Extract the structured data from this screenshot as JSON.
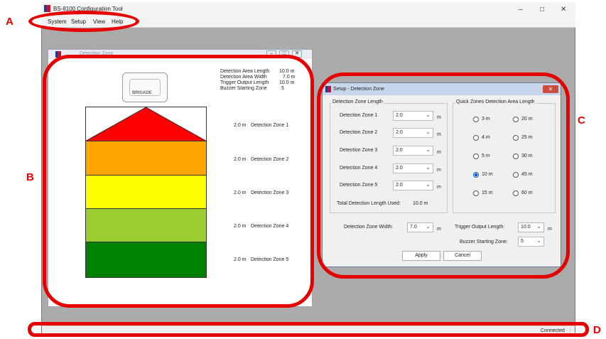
{
  "app": {
    "title": "BS-8100 Configuration Tool",
    "menu": [
      "System",
      "Setup",
      "View",
      "Help"
    ]
  },
  "detection_window": {
    "title": "Detection Zone",
    "info_labels": [
      "Detection Area Length",
      "Detection Area Width",
      "Trigger Output Length",
      "Buzzer Starting Zone"
    ],
    "info_values": [
      "10.0 m",
      "7.0 m",
      "10.0 m",
      "5"
    ],
    "device_brand": "BRIGADE",
    "zones": [
      {
        "length": "2.0 m",
        "name": "Detection Zone 1",
        "color": "#ff0000"
      },
      {
        "length": "2.0 m",
        "name": "Detection Zone 2",
        "color": "#ffa500"
      },
      {
        "length": "2.0 m",
        "name": "Detection Zone 3",
        "color": "#ffff00"
      },
      {
        "length": "2.0 m",
        "name": "Detection Zone 4",
        "color": "#9acd32"
      },
      {
        "length": "2.0 m",
        "name": "Detection Zone 5",
        "color": "#008000"
      }
    ]
  },
  "setup_dialog": {
    "title": "Setup - Detection Zone",
    "length_group_title": "Detection Zone Length",
    "zone_labels": [
      "Detection Zone 1",
      "Detection Zone 2",
      "Detection Zone 3",
      "Detection Zone 4",
      "Detection Zone 5"
    ],
    "zone_values": [
      "2.0",
      "2.0",
      "2.0",
      "2.0",
      "2.0"
    ],
    "unit": "m",
    "total_label": "Total Detection Length Used:",
    "total_value": "10.0 m",
    "quick_group_title": "Quick Zones Detection Area Length",
    "quick_options_left": [
      "3 m",
      "4 m",
      "5 m",
      "10 m",
      "15 m"
    ],
    "quick_options_right": [
      "20 m",
      "25 m",
      "30 m",
      "45 m",
      "60 m"
    ],
    "quick_selected": "10 m",
    "width_label": "Detection Zone Width:",
    "width_value": "7.0",
    "trigger_label": "Trigger Output Length:",
    "trigger_value": "10.0",
    "buzzer_label": "Buzzer Starting Zone:",
    "buzzer_value": "5",
    "apply_label": "Apply",
    "cancel_label": "Cancel"
  },
  "status": {
    "text": "Connected"
  },
  "callouts": [
    "A",
    "B",
    "C",
    "D"
  ]
}
